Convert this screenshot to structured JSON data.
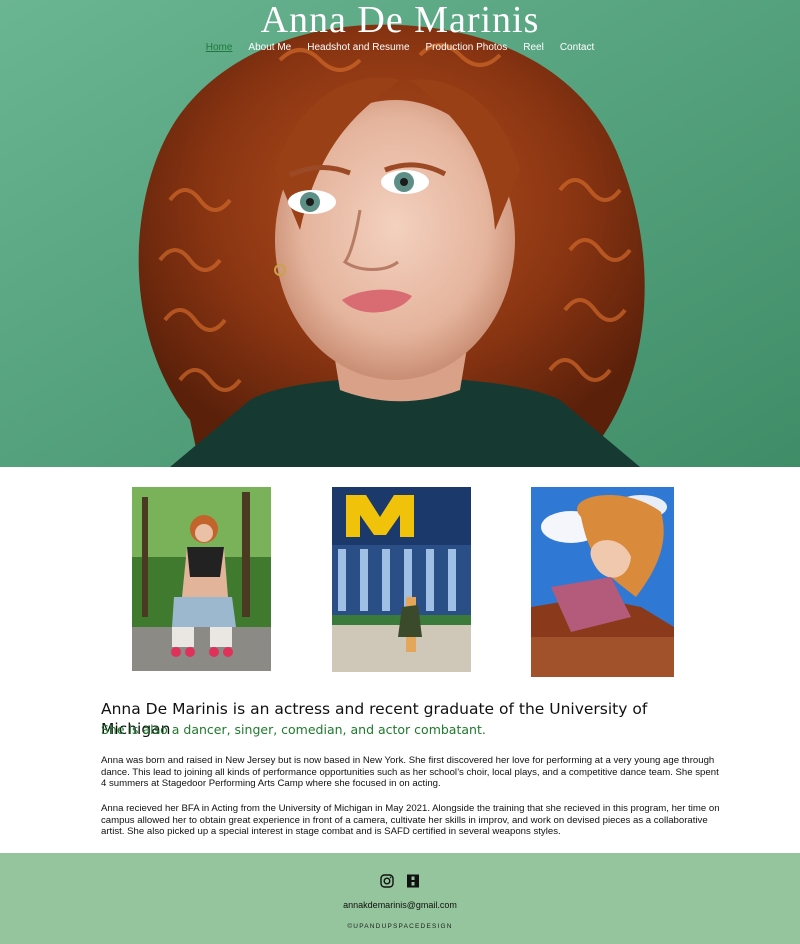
{
  "site": {
    "title": "Anna De Marinis"
  },
  "nav": {
    "items": [
      {
        "label": "Home",
        "active": true
      },
      {
        "label": "About Me",
        "active": false
      },
      {
        "label": "Headshot and Resume",
        "active": false
      },
      {
        "label": "Production Photos",
        "active": false
      },
      {
        "label": "Reel",
        "active": false
      },
      {
        "label": "Contact",
        "active": false
      }
    ]
  },
  "content": {
    "headline": "Anna De Marinis is an actress and recent graduate of the University of Michigan",
    "subhead": "She is also a dancer, singer, comedian, and actor combatant.",
    "paragraph1": "Anna was born and raised in New Jersey but is now based in New York. She first discovered her love for performing at a very young age through dance. This lead to joining all kinds of performance opportunities such as her school’s choir, local plays, and a competitive dance team. She spent 4 summers at Stagedoor Performing Arts Camp where she focused in on acting.",
    "paragraph2": "Anna recieved her BFA in Acting from the University of Michigan in May 2021. Alongside the training that she recieved in this program, her time on campus allowed her to obtain great experience in front of a camera, cultivate her skills in improv, and work on devised pieces as a collaborative artist. She also picked up a special interest in stage combat and is SAFD certified in several weapons styles."
  },
  "footer": {
    "email": "annakdemarinis@gmail.com",
    "credit": "©UPANDUPSPACEDESIGN",
    "icons": [
      "instagram-icon",
      "backstage-icon"
    ]
  },
  "colors": {
    "hero_bg": "#5fa883",
    "accent_green": "#1e7a2c",
    "footer_bg": "#94c59c"
  }
}
